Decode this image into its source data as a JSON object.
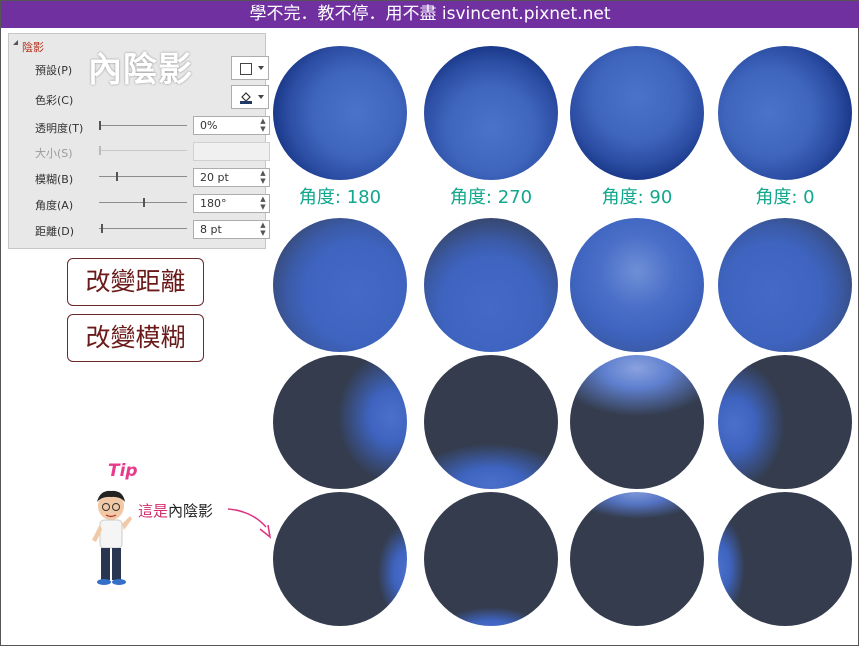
{
  "header": {
    "title": "學不完．教不停．用不盡 isvincent.pixnet.net"
  },
  "panel": {
    "section_label": "陰影",
    "big_title": "內陰影",
    "rows": [
      {
        "label": "預設(P)",
        "kind": "preset"
      },
      {
        "label": "色彩(C)",
        "kind": "color"
      },
      {
        "label": "透明度(T)",
        "value": "0%"
      },
      {
        "label": "大小(S)",
        "value": "",
        "disabled": true
      },
      {
        "label": "模糊(B)",
        "value": "20 pt"
      },
      {
        "label": "角度(A)",
        "value": "180°"
      },
      {
        "label": "距離(D)",
        "value": "8 pt"
      }
    ]
  },
  "labels": {
    "change_distance": "改變距離",
    "change_blur": "改變模糊"
  },
  "angles": [
    "角度: 180",
    "角度: 270",
    "角度: 90",
    "角度: 0"
  ],
  "tip": {
    "word": "Tip",
    "note_prefix": "這是",
    "note_main": "內陰影"
  },
  "colors": {
    "accent": "#7030a0",
    "angle_text": "#13a88d",
    "ball_blue": "#3e64c0",
    "shadow_dark": "#343c4d",
    "label_text": "#6b1a1a"
  }
}
